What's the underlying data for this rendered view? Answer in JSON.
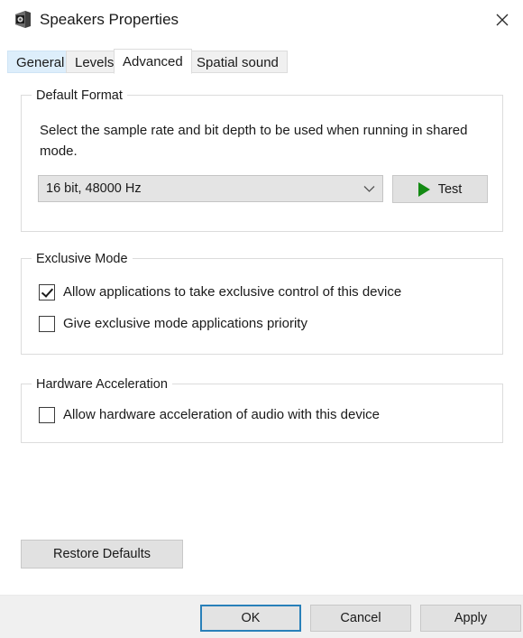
{
  "window": {
    "title": "Speakers Properties",
    "icon": "speaker-icon",
    "close_label": "✕"
  },
  "tabs": [
    {
      "id": "general",
      "label": "General",
      "state": "hover"
    },
    {
      "id": "levels",
      "label": "Levels",
      "state": "normal"
    },
    {
      "id": "advanced",
      "label": "Advanced",
      "state": "selected"
    },
    {
      "id": "spatial",
      "label": "Spatial sound",
      "state": "normal"
    }
  ],
  "default_format": {
    "group_title": "Default Format",
    "description": "Select the sample rate and bit depth to be used when running in shared mode.",
    "combo": {
      "value": "16 bit, 48000 Hz",
      "arrow_icon": "chevron-down-icon"
    },
    "test_button": {
      "label": "Test",
      "icon": "play-icon",
      "icon_color": "#138a13"
    }
  },
  "exclusive_mode": {
    "group_title": "Exclusive Mode",
    "checkboxes": [
      {
        "label": "Allow applications to take exclusive control of this device",
        "checked": true
      },
      {
        "label": "Give exclusive mode applications priority",
        "checked": false
      }
    ]
  },
  "hardware_acceleration": {
    "group_title": "Hardware Acceleration",
    "checkboxes": [
      {
        "label": "Allow hardware acceleration of audio with this device",
        "checked": false
      }
    ]
  },
  "restore_defaults": {
    "label": "Restore Defaults"
  },
  "footer": {
    "ok_label": "OK",
    "cancel_label": "Cancel",
    "apply_label": "Apply",
    "focus_color": "#2980b9"
  }
}
